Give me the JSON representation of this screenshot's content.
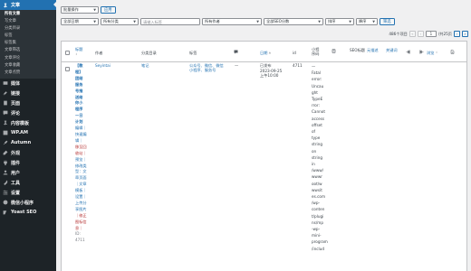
{
  "sidebar": {
    "items": [
      {
        "label": "文章",
        "icon": "pin-icon",
        "current": true
      },
      {
        "label": "媒体",
        "icon": "media-icon"
      },
      {
        "label": "链接",
        "icon": "link-icon"
      },
      {
        "label": "页面",
        "icon": "page-icon"
      },
      {
        "label": "评论",
        "icon": "comment-icon"
      },
      {
        "label": "内容模板",
        "icon": "pin-icon"
      },
      {
        "label": "WP.AM",
        "icon": "wpam-icon"
      },
      {
        "label": "Autumn",
        "icon": "brush-icon"
      },
      {
        "label": "外观",
        "icon": "appearance-icon"
      },
      {
        "label": "插件",
        "icon": "plugin-icon"
      },
      {
        "label": "用户",
        "icon": "user-icon"
      },
      {
        "label": "工具",
        "icon": "tools-icon"
      },
      {
        "label": "设置",
        "icon": "settings-icon"
      },
      {
        "label": "微信小程序",
        "icon": "miniprogram-icon"
      },
      {
        "label": "Yoast SEO",
        "icon": "yoast-icon"
      }
    ],
    "submenu": [
      "所有文章",
      "写文章",
      "分类目录",
      "标签",
      "标签集",
      "文章筛选",
      "文章评论",
      "文章收藏",
      "文章点赞"
    ]
  },
  "filters": {
    "bulk_action": "批量操作",
    "apply": "应用",
    "all_dates": "全部日期",
    "all_categories": "所有分类",
    "tag_placeholder": "请输入标签",
    "all_authors": "所有作者",
    "all_seo": "全部SEO分数",
    "sort_by": "排序",
    "order": "降序",
    "filter": "筛选"
  },
  "pagination": {
    "count": "486个项目",
    "first": "«",
    "prev": "‹",
    "current_page": "1",
    "total": "/共25页",
    "next": "›",
    "last": "»"
  },
  "columns": {
    "title": "标题",
    "author": "作者",
    "category": "分类目录",
    "tags": "标签",
    "comments_icon": "comment-bubble-icon",
    "date": "日期",
    "id": "id",
    "mini_prog": "小程序码",
    "seo_icon": "seo-icon",
    "seo_title": "SEO标题",
    "seo_desc": "元描述",
    "seo_keyword": "关键词",
    "links_in": "outgoing-links-icon",
    "links_out": "incoming-links-icon",
    "views": "浏览",
    "extra_icon": "doc-icon"
  },
  "rows": [
    {
      "title_lines": [
        "【教",
        "程】",
        "团结",
        "服务",
        "号推",
        "送给",
        "你小",
        "程序",
        "—日",
        "计划"
      ],
      "actions": [
        {
          "text": "编辑｜",
          "tone": "link"
        },
        {
          "text": "快速编",
          "tone": "link"
        },
        {
          "text": "辑｜",
          "tone": "link"
        },
        {
          "text": "移至回",
          "tone": "red"
        },
        {
          "text": "收站｜",
          "tone": "red"
        },
        {
          "text": "预览｜",
          "tone": "link"
        },
        {
          "text": "修改类",
          "tone": "link"
        },
        {
          "text": "型：文",
          "tone": "link"
        },
        {
          "text": "章页面",
          "tone": "link"
        },
        {
          "text": "｜文章",
          "tone": "link"
        },
        {
          "text": "模板｜",
          "tone": "link"
        },
        {
          "text": "设置｜",
          "tone": "link"
        },
        {
          "text": "上传分",
          "tone": "link"
        },
        {
          "text": "享图片",
          "tone": "link"
        },
        {
          "text": "｜修正",
          "tone": "red"
        },
        {
          "text": "图标信",
          "tone": "red"
        },
        {
          "text": "息｜",
          "tone": "red"
        },
        {
          "text": "ID:",
          "tone": "grey"
        },
        {
          "text": "4711",
          "tone": "grey"
        }
      ],
      "author": "Seyintai",
      "category": "笔记",
      "tags": [
        "公众号、微信、微信",
        "小程序、服务号"
      ],
      "comments": "—",
      "date": [
        "已发布",
        "2023-09-25",
        "上午10:00"
      ],
      "id": "4711",
      "mini_prog": "—",
      "location_lines": [
        "Fatal",
        "error:",
        "Uncau",
        "ght",
        "TypeE",
        "rror:",
        "Cannot",
        "access",
        "offset",
        "of",
        "type",
        "string",
        "on",
        "string",
        "in",
        "/www/",
        "wwwr",
        "oot/w",
        "wwsit",
        "es.com",
        "/wp-",
        "conten",
        "t/plugi",
        "ns/mp",
        "-wp-",
        "mini-",
        "program",
        "/includ"
      ]
    }
  ]
}
